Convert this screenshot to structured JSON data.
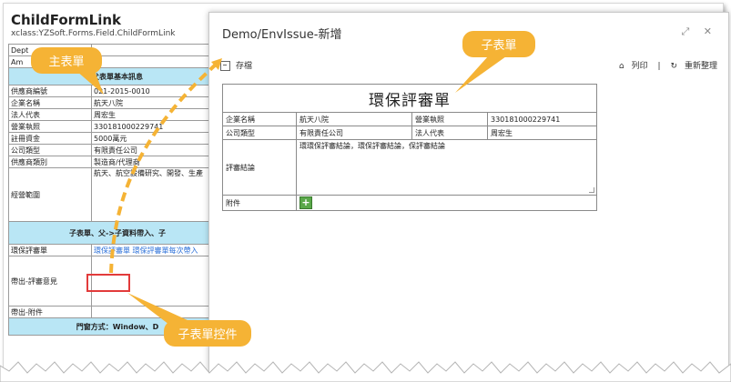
{
  "background_form": {
    "title": "ChildFormLink",
    "subtitle": "xclass:YZSoft.Forms.Field.ChildFormLink",
    "rows_top": [
      {
        "label": "Dept",
        "value": ""
      },
      {
        "label": "Am",
        "value": ""
      }
    ],
    "section1": "父表單基本訊息",
    "rows": [
      {
        "label": "供應商編號",
        "value": "021-2015-0010"
      },
      {
        "label": "企業名稱",
        "value": "航天八院"
      },
      {
        "label": "法人代表",
        "value": "周宏生"
      },
      {
        "label": "營業執照",
        "value": "330181000229741"
      },
      {
        "label": "註冊資金",
        "value": "5000萬元"
      },
      {
        "label": "公司類型",
        "value": "有限責任公司"
      },
      {
        "label": "供應商類別",
        "value": "製造商/代理商"
      },
      {
        "label": "經營範圍",
        "value": "航天、航空設備研究、開發、生產"
      }
    ],
    "section2": "子表單、父->子資料帶入、子",
    "link_row": {
      "label": "環保評審單",
      "link1": "環保評審單",
      "link2": "環保評審單每次帶入"
    },
    "row_review": {
      "label": "帶出-評審意見"
    },
    "row_attach": {
      "label": "帶出-附件"
    },
    "section3": "門窗方式：Window、D"
  },
  "dialog": {
    "title": "Demo/EnvIssue-新增",
    "controls": "⤢ ✕",
    "toolbar": {
      "save": "存檔",
      "print": "列印",
      "separator": "|",
      "refresh": "重新整理"
    },
    "form": {
      "caption": "環保評審單",
      "company_label": "企業名稱",
      "company_value": "航天八院",
      "license_label": "營業執照",
      "license_value": "330181000229741",
      "type_label": "公司類型",
      "type_value": "有限責任公司",
      "rep_label": "法人代表",
      "rep_value": "周宏生",
      "review_label": "評審結論",
      "review_value": "環環保評審結論，環保評審結論，保評審結論",
      "attach_label": "附件",
      "add_label": "+"
    }
  },
  "callouts": {
    "main_form": "主表單",
    "child_form": "子表單",
    "child_control": "子表單控件"
  },
  "colors": {
    "accent": "#f5b335",
    "section": "#b9e6f5",
    "link": "#2a6fd8",
    "highlight": "#e23b3b"
  }
}
